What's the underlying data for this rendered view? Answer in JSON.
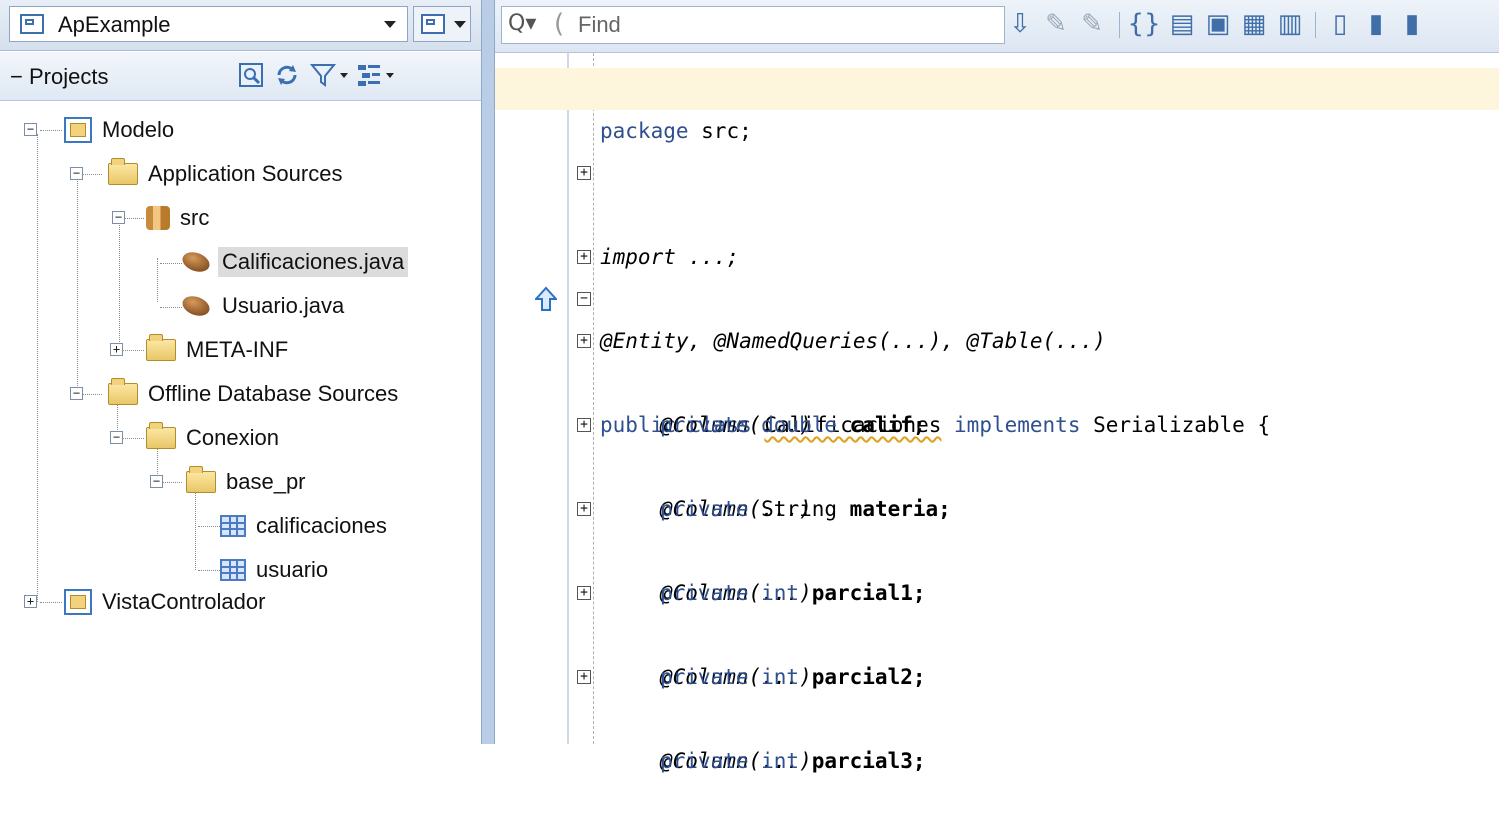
{
  "app_selector": {
    "label": "ApExample"
  },
  "projects_panel": {
    "title": "Projects",
    "tree": [
      {
        "label": "Modelo",
        "icon": "project-icon",
        "expander": "minus"
      },
      {
        "label": "Application Sources",
        "icon": "folder-icon",
        "expander": "minus"
      },
      {
        "label": "src",
        "icon": "package-icon",
        "expander": "minus"
      },
      {
        "label": "Calificaciones.java",
        "icon": "java-bean-icon",
        "selected": true
      },
      {
        "label": "Usuario.java",
        "icon": "java-bean-icon"
      },
      {
        "label": "META-INF",
        "icon": "folder-icon",
        "expander": "plus"
      },
      {
        "label": "Offline Database Sources",
        "icon": "folder-icon",
        "expander": "minus"
      },
      {
        "label": "Conexion",
        "icon": "folder-icon",
        "expander": "minus"
      },
      {
        "label": "base_pr",
        "icon": "folder-icon",
        "expander": "minus"
      },
      {
        "label": "calificaciones",
        "icon": "table-icon"
      },
      {
        "label": "usuario",
        "icon": "table-icon"
      },
      {
        "label": "VistaControlador",
        "icon": "project-icon",
        "expander": "plus"
      }
    ]
  },
  "editor": {
    "find_placeholder": "Find",
    "code": {
      "package_kw": "package",
      "package_rest": " src;",
      "import_kw": "import",
      "import_rest": " ...;",
      "annotations": "@Entity, @NamedQueries(...), @Table(...)",
      "class_public": "public class ",
      "class_name": "Calificaciones",
      "class_implements": " implements ",
      "class_iface": "Serializable {",
      "column_annotation": "@Column(...)",
      "field1_mod": "private double ",
      "field1_name": "calif;",
      "field2_mod": "private ",
      "field2_type": "String ",
      "field2_name": "materia;",
      "field3_mod": "private int ",
      "field3_name": "parcial1;",
      "field4_mod": "private int ",
      "field4_name": "parcial2;",
      "field5_mod": "private int ",
      "field5_name": "parcial3;"
    },
    "fold_plus": "+",
    "fold_minus": "−"
  },
  "colors": {
    "keyword": "#2f4f8f",
    "current_line": "#fdf6dc",
    "selection": "#dcdcdc",
    "panel_header": "#dfe8f3"
  }
}
